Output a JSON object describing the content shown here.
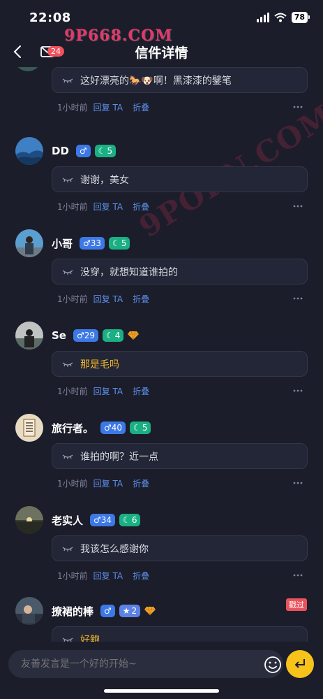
{
  "status": {
    "time": "22:08",
    "battery": "78"
  },
  "watermark": {
    "primary": "9P668.COM",
    "secondary": "9PORN.COM"
  },
  "nav": {
    "title": "信件详情",
    "mail_count": "24"
  },
  "colors": {
    "background": "#1b1d2a",
    "accent_link": "#5d8ee8",
    "gender_badge": "#3d79e6",
    "level_badge": "#1ab083",
    "send_button": "#f7c31b"
  },
  "comments": [
    {
      "username": "",
      "gender_badge": "",
      "level": "",
      "reply": "这好漂亮的🐎🐶啊！黑漆漆的鐾笔",
      "time": "1小时前",
      "reply_action": "回复 TA",
      "fold_action": "折叠",
      "reply_highlight": false
    },
    {
      "username": "DD",
      "gender_badge": "♂",
      "level": "5",
      "reply": "谢谢，美女",
      "time": "1小时前",
      "reply_action": "回复 TA",
      "fold_action": "折叠",
      "reply_highlight": false
    },
    {
      "username": "小哥",
      "gender_badge": "♂33",
      "level": "5",
      "reply": "没穿，就想知道谁拍的",
      "time": "1小时前",
      "reply_action": "回复 TA",
      "fold_action": "折叠",
      "reply_highlight": false
    },
    {
      "username": "Se",
      "gender_badge": "♂29",
      "level": "4",
      "reply": "那是毛吗",
      "time": "1小时前",
      "reply_action": "回复 TA",
      "fold_action": "折叠",
      "reply_highlight": true,
      "has_gem": true
    },
    {
      "username": "旅行者。",
      "gender_badge": "♂40",
      "level": "5",
      "reply": "谁拍的啊？近一点",
      "time": "1小时前",
      "reply_action": "回复 TA",
      "fold_action": "折叠",
      "reply_highlight": false
    },
    {
      "username": "老实人",
      "gender_badge": "♂34",
      "level": "6",
      "reply": "我该怎么感谢你",
      "time": "1小时前",
      "reply_action": "回复 TA",
      "fold_action": "折叠",
      "reply_highlight": false
    },
    {
      "username": "撩裙的棒",
      "gender_badge": "♂",
      "level": "2",
      "reply": "好鲍",
      "time": "",
      "reply_action": "",
      "fold_action": "",
      "reply_highlight": true,
      "has_gem": true,
      "tag": "戳过"
    }
  ],
  "composer": {
    "placeholder": "友善发言是一个好的开始~"
  }
}
